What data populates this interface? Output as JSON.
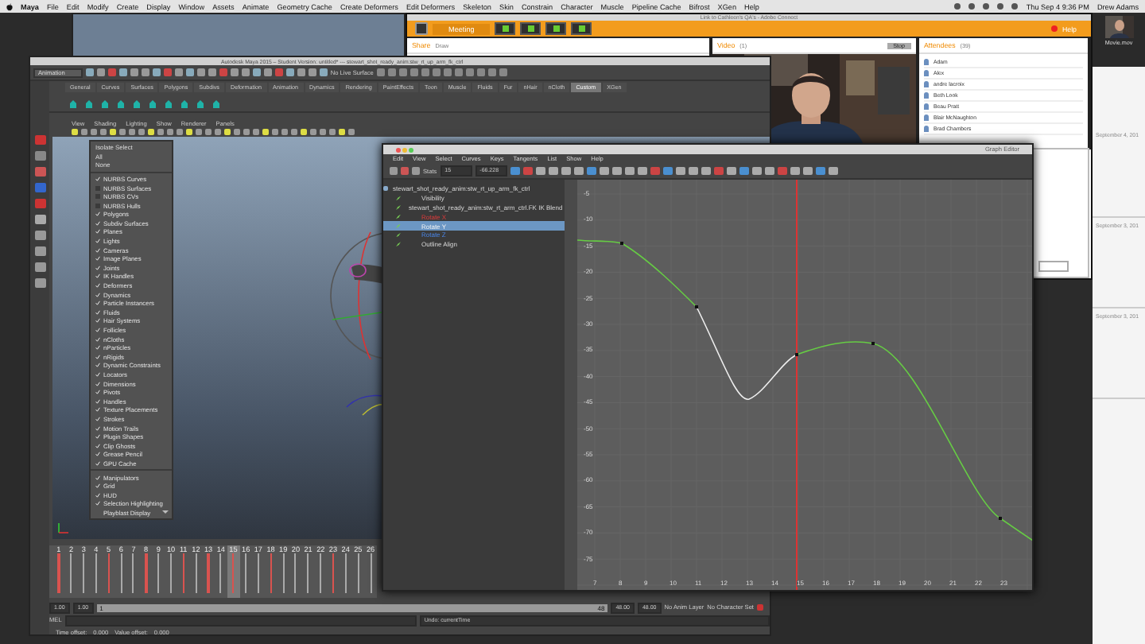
{
  "menubar": {
    "app": "Maya",
    "menus": [
      "File",
      "Edit",
      "Modify",
      "Create",
      "Display",
      "Window",
      "Assets",
      "Animate",
      "Geometry Cache",
      "Create Deformers",
      "Edit Deformers",
      "Skeleton",
      "Skin",
      "Constrain",
      "Character",
      "Muscle",
      "Pipeline Cache",
      "Bifrost",
      "XGen",
      "Help"
    ],
    "clock": "Thu Sep 4  9:36 PM",
    "user": "Drew Adams"
  },
  "connect": {
    "title": "Link to Cathleen's QA's - Adobe Connect",
    "menu": "Meeting",
    "help": "Help",
    "share_pod": {
      "title": "Share",
      "mode": "Draw"
    },
    "video_pod": {
      "title": "Video",
      "count": "(1)",
      "button": "Stop"
    },
    "attendees": {
      "title": "Attendees",
      "count": "(39)",
      "names": [
        "Adam",
        "Alex",
        "andre lacroix",
        "Beth Look",
        "Beau Pratt",
        "Blair McNaughton",
        "Brad Chambers"
      ]
    }
  },
  "side_panel": {
    "movie": "Movie.mov",
    "dates": [
      "September 4, 201",
      "September 3, 201",
      "September 3, 201"
    ]
  },
  "maya": {
    "title": "Autodesk Maya 2015 – Student Version: untitled*  ---  stewart_shot_ready_anim:stw_rt_up_arm_fk_ctrl",
    "mode": "Animation",
    "live_surface": "No Live Surface",
    "shelf_tabs": [
      {
        "label": "General",
        "selected": false
      },
      {
        "label": "Curves",
        "selected": false
      },
      {
        "label": "Surfaces",
        "selected": false
      },
      {
        "label": "Polygons",
        "selected": false
      },
      {
        "label": "Subdivs",
        "selected": false
      },
      {
        "label": "Deformation",
        "selected": false
      },
      {
        "label": "Animation",
        "selected": false
      },
      {
        "label": "Dynamics",
        "selected": false
      },
      {
        "label": "Rendering",
        "selected": false
      },
      {
        "label": "PaintEffects",
        "selected": false
      },
      {
        "label": "Toon",
        "selected": false
      },
      {
        "label": "Muscle",
        "selected": false
      },
      {
        "label": "Fluids",
        "selected": false
      },
      {
        "label": "Fur",
        "selected": false
      },
      {
        "label": "nHair",
        "selected": false
      },
      {
        "label": "nCloth",
        "selected": false
      },
      {
        "label": "Custom",
        "selected": true
      },
      {
        "label": "XGen",
        "selected": false
      }
    ],
    "panel_menus": [
      "View",
      "Shading",
      "Lighting",
      "Show",
      "Renderer",
      "Panels"
    ],
    "show_menu": [
      {
        "kind": "command",
        "label": "Isolate Select"
      },
      {
        "kind": "command",
        "label": "All"
      },
      {
        "kind": "command",
        "label": "None"
      },
      {
        "kind": "separator"
      },
      {
        "kind": "check",
        "label": "NURBS Curves",
        "checked": true
      },
      {
        "kind": "check",
        "label": "NURBS Surfaces",
        "checked": false
      },
      {
        "kind": "check",
        "label": "NURBS CVs",
        "checked": false
      },
      {
        "kind": "check",
        "label": "NURBS Hulls",
        "checked": false
      },
      {
        "kind": "check",
        "label": "Polygons",
        "checked": true
      },
      {
        "kind": "check",
        "label": "Subdiv Surfaces",
        "checked": true
      },
      {
        "kind": "check",
        "label": "Planes",
        "checked": true
      },
      {
        "kind": "check",
        "label": "Lights",
        "checked": true
      },
      {
        "kind": "check",
        "label": "Cameras",
        "checked": true
      },
      {
        "kind": "check",
        "label": "Image Planes",
        "checked": true
      },
      {
        "kind": "check",
        "label": "Joints",
        "checked": true
      },
      {
        "kind": "check",
        "label": "IK Handles",
        "checked": true
      },
      {
        "kind": "check",
        "label": "Deformers",
        "checked": true
      },
      {
        "kind": "check",
        "label": "Dynamics",
        "checked": true
      },
      {
        "kind": "check",
        "label": "Particle Instancers",
        "checked": true
      },
      {
        "kind": "check",
        "label": "Fluids",
        "checked": true
      },
      {
        "kind": "check",
        "label": "Hair Systems",
        "checked": true
      },
      {
        "kind": "check",
        "label": "Follicles",
        "checked": true
      },
      {
        "kind": "check",
        "label": "nCloths",
        "checked": true
      },
      {
        "kind": "check",
        "label": "nParticles",
        "checked": true
      },
      {
        "kind": "check",
        "label": "nRigids",
        "checked": true
      },
      {
        "kind": "check",
        "label": "Dynamic Constraints",
        "checked": true
      },
      {
        "kind": "check",
        "label": "Locators",
        "checked": true
      },
      {
        "kind": "check",
        "label": "Dimensions",
        "checked": true
      },
      {
        "kind": "check",
        "label": "Pivots",
        "checked": true
      },
      {
        "kind": "check",
        "label": "Handles",
        "checked": true
      },
      {
        "kind": "check",
        "label": "Texture Placements",
        "checked": true
      },
      {
        "kind": "check",
        "label": "Strokes",
        "checked": true
      },
      {
        "kind": "check",
        "label": "Motion Trails",
        "checked": true
      },
      {
        "kind": "check",
        "label": "Plugin Shapes",
        "checked": true
      },
      {
        "kind": "check",
        "label": "Clip Ghosts",
        "checked": true
      },
      {
        "kind": "check",
        "label": "Grease Pencil",
        "checked": true
      },
      {
        "kind": "check",
        "label": "GPU Cache",
        "checked": true
      },
      {
        "kind": "separator"
      },
      {
        "kind": "check",
        "label": "Manipulators",
        "checked": true
      },
      {
        "kind": "check",
        "label": "Grid",
        "checked": true
      },
      {
        "kind": "check",
        "label": "HUD",
        "checked": true
      },
      {
        "kind": "check",
        "label": "Selection Highlighting",
        "checked": true
      },
      {
        "kind": "submenu",
        "label": "Playblast Display"
      }
    ],
    "timeline": [
      {
        "label": "1",
        "key": true,
        "selected": false
      },
      {
        "label": "2",
        "key": false,
        "selected": false
      },
      {
        "label": "3",
        "key": false,
        "selected": false
      },
      {
        "label": "4",
        "key": false,
        "selected": false
      },
      {
        "label": "5",
        "key": true,
        "selected": false
      },
      {
        "label": "6",
        "key": false,
        "selected": false
      },
      {
        "label": "7",
        "key": false,
        "selected": false
      },
      {
        "label": "8",
        "key": true,
        "selected": false
      },
      {
        "label": "9",
        "key": false,
        "selected": false
      },
      {
        "label": "10",
        "key": false,
        "selected": false
      },
      {
        "label": "11",
        "key": true,
        "selected": false
      },
      {
        "label": "12",
        "key": false,
        "selected": false
      },
      {
        "label": "13",
        "key": true,
        "selected": false
      },
      {
        "label": "14",
        "key": false,
        "selected": false
      },
      {
        "label": "15",
        "key": true,
        "selected": true
      },
      {
        "label": "16",
        "key": false,
        "selected": false
      },
      {
        "label": "17",
        "key": false,
        "selected": false
      },
      {
        "label": "18",
        "key": true,
        "selected": false
      },
      {
        "label": "19",
        "key": false,
        "selected": false
      },
      {
        "label": "20",
        "key": false,
        "selected": false
      },
      {
        "label": "21",
        "key": false,
        "selected": false
      },
      {
        "label": "22",
        "key": false,
        "selected": false
      },
      {
        "label": "23",
        "key": true,
        "selected": false
      },
      {
        "label": "24",
        "key": false,
        "selected": false
      },
      {
        "label": "25",
        "key": false,
        "selected": false
      },
      {
        "label": "26",
        "key": false,
        "selected": false
      }
    ],
    "range": {
      "start": "1.00",
      "inner_start": "1.00",
      "level": 1,
      "slider_start": "1",
      "slider_end": "48",
      "inner_end": "48.00",
      "end": "48.00",
      "anim_layer": "No Anim Layer",
      "character_set": "No Character Set"
    },
    "command_line": {
      "language": "MEL",
      "result": "Undo: currentTime"
    },
    "help_line": {
      "time_label": "Time offset:",
      "time": "0.000",
      "value_label": "Value offset:",
      "value": "0.000"
    }
  },
  "graph_editor": {
    "title": "Graph Editor",
    "menus": [
      "Edit",
      "View",
      "Select",
      "Curves",
      "Keys",
      "Tangents",
      "List",
      "Show",
      "Help"
    ],
    "stats_label": "Stats",
    "frame": "15",
    "value": "-66.228",
    "outliner": [
      {
        "label": "stewart_shot_ready_anim:stw_rt_up_arm_fk_ctrl",
        "selected": false,
        "children": [
          {
            "label": "Visibility",
            "selected": false,
            "kind": "plain"
          },
          {
            "label": "stewart_shot_ready_anim:stw_rt_arm_ctrl.FK IK Blend",
            "selected": false,
            "kind": "plain"
          },
          {
            "label": "Rotate X",
            "selected": false,
            "kind": "x_axis"
          },
          {
            "label": "Rotate Y",
            "selected": true,
            "kind": "y_axis"
          },
          {
            "label": "Rotate Z",
            "selected": false,
            "kind": "z_axis"
          },
          {
            "label": "Outline Align",
            "selected": false,
            "kind": "plain"
          }
        ]
      }
    ],
    "y_labels": [
      "-5",
      "-10",
      "-15",
      "-20",
      "-25",
      "-30",
      "-35",
      "-40",
      "-45",
      "-50",
      "-55",
      "-60",
      "-65",
      "-70",
      "-75"
    ],
    "x_labels": [
      "7",
      "8",
      "9",
      "10",
      "11",
      "12",
      "13",
      "14",
      "15",
      "16",
      "17",
      "18",
      "19",
      "20",
      "21",
      "22",
      "23"
    ]
  }
}
